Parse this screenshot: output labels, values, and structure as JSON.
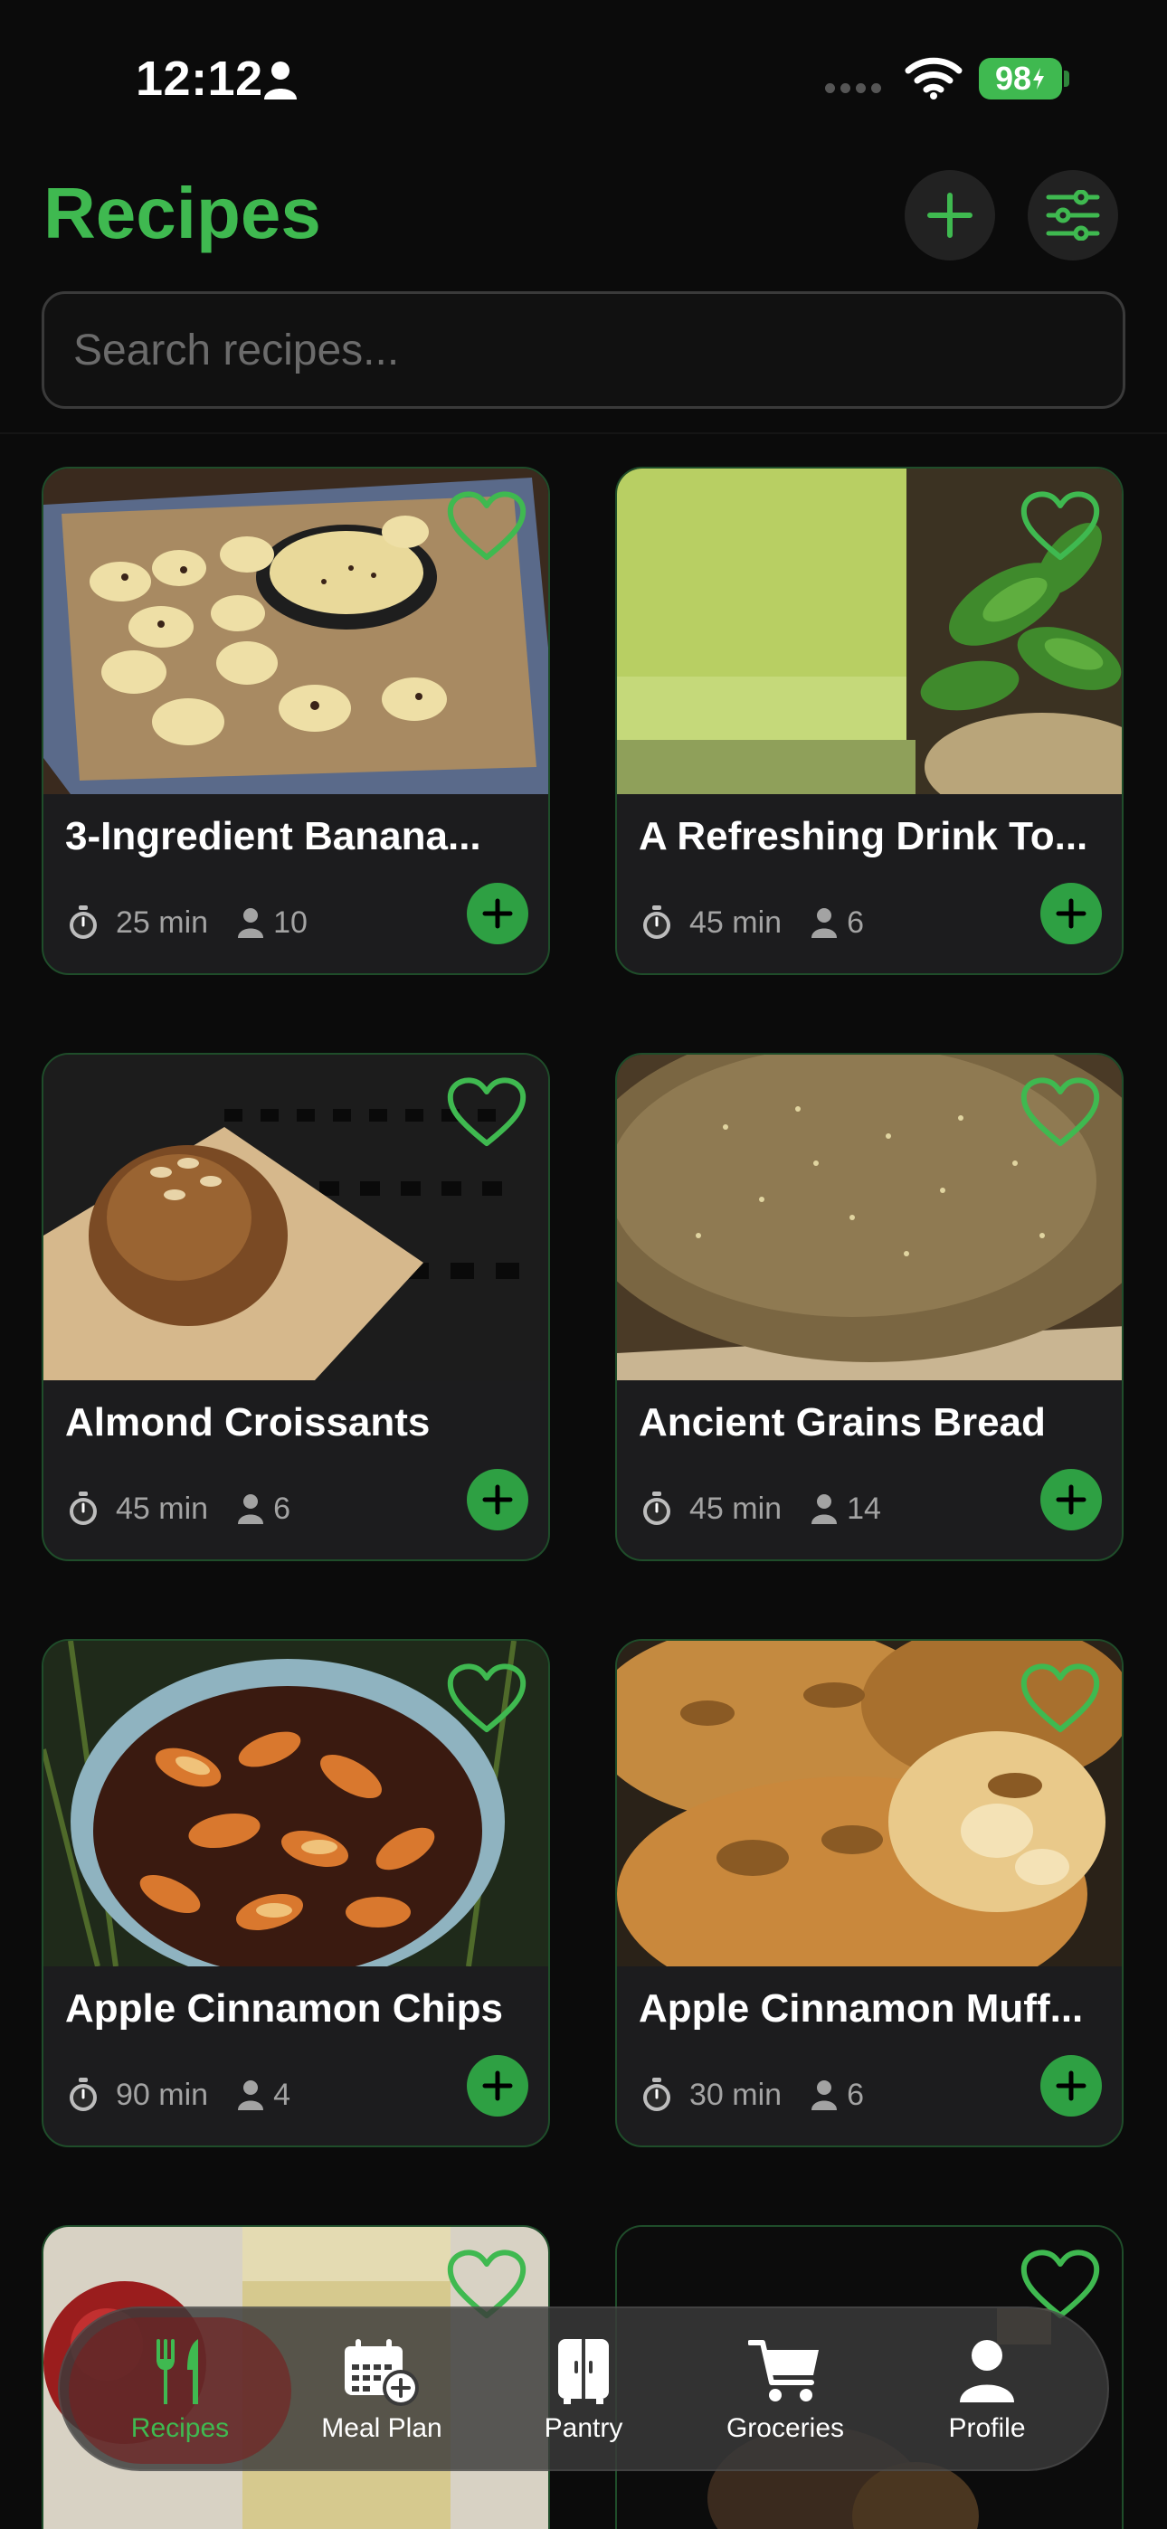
{
  "status_bar": {
    "time": "12:12",
    "battery": "98"
  },
  "header": {
    "title": "Recipes"
  },
  "search": {
    "placeholder": "Search recipes..."
  },
  "recipes": [
    {
      "title": "3-Ingredient Banana...",
      "time": "25 min",
      "servings": "10"
    },
    {
      "title": "A Refreshing Drink To...",
      "time": "45 min",
      "servings": "6"
    },
    {
      "title": "Almond Croissants",
      "time": "45 min",
      "servings": "6"
    },
    {
      "title": "Ancient Grains Bread",
      "time": "45 min",
      "servings": "14"
    },
    {
      "title": "Apple Cinnamon Chips",
      "time": "90 min",
      "servings": "4"
    },
    {
      "title": "Apple Cinnamon Muff...",
      "time": "30 min",
      "servings": "6"
    }
  ],
  "tabs": [
    {
      "label": "Recipes",
      "icon": "fork-knife-icon",
      "active": true
    },
    {
      "label": "Meal Plan",
      "icon": "calendar-add-icon",
      "active": false
    },
    {
      "label": "Pantry",
      "icon": "cabinet-icon",
      "active": false
    },
    {
      "label": "Groceries",
      "icon": "cart-icon",
      "active": false
    },
    {
      "label": "Profile",
      "icon": "person-icon",
      "active": false
    }
  ],
  "colors": {
    "accent": "#3fb950",
    "background": "#0b0b0b",
    "card": "#1c1c1e"
  }
}
